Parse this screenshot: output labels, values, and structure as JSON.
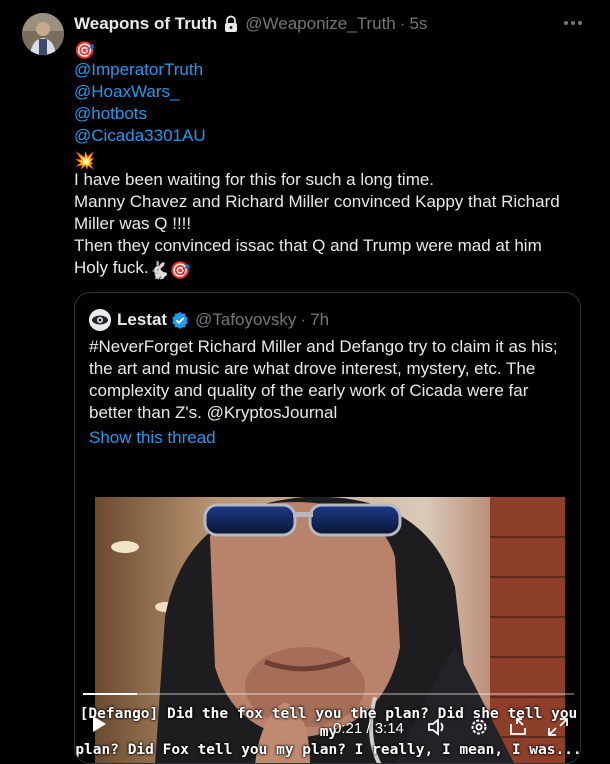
{
  "tweet": {
    "display_name": "Weapons of Truth",
    "handle": "@Weaponize_Truth",
    "time": "5s",
    "lines": [
      {
        "emoji": "🎯"
      },
      {
        "mention": "@ImperatorTruth"
      },
      {
        "mention": "@HoaxWars_"
      },
      {
        "mention": "@hotbots"
      },
      {
        "mention": "@Cicada3301AU"
      },
      {
        "emoji": "💥"
      },
      {
        "text": "I have been waiting for this for such a long time."
      },
      {
        "text": "Manny Chavez and Richard Miller convinced Kappy that Richard"
      },
      {
        "text": "Miller was Q !!!!"
      },
      {
        "text": "Then they convinced issac that Q and Trump were mad at him"
      },
      {
        "text": "Holy fuck.",
        "emoji_after": "🐇🎯"
      }
    ]
  },
  "quote": {
    "display_name": "Lestat",
    "handle": "@Tafoyovsky",
    "time": "7h",
    "lines": [
      "#NeverForget Richard Miller and Defango try to claim it as his;",
      "the art and music are what drove interest, mystery, etc. The",
      "complexity and quality of the early work of Cicada were far",
      "better than Z's. @KryptosJournal"
    ],
    "show_thread": "Show this thread",
    "video": {
      "progress": 0.11,
      "caption_line1": "[Defango] Did the fox tell you the plan? Did she tell you my",
      "caption_line2": "plan? Did Fox tell you my plan? I really, I mean, I was...",
      "time": "0:21 / 3:14"
    }
  },
  "colors": {
    "accent": "#1d9bf0",
    "muted": "#71767b",
    "text": "#e7e9ea",
    "border": "#2f3336"
  },
  "icons": [
    "lock-icon",
    "more-icon",
    "verified-icon",
    "play-icon",
    "volume-icon",
    "settings-icon",
    "pip-icon",
    "fullscreen-icon"
  ]
}
